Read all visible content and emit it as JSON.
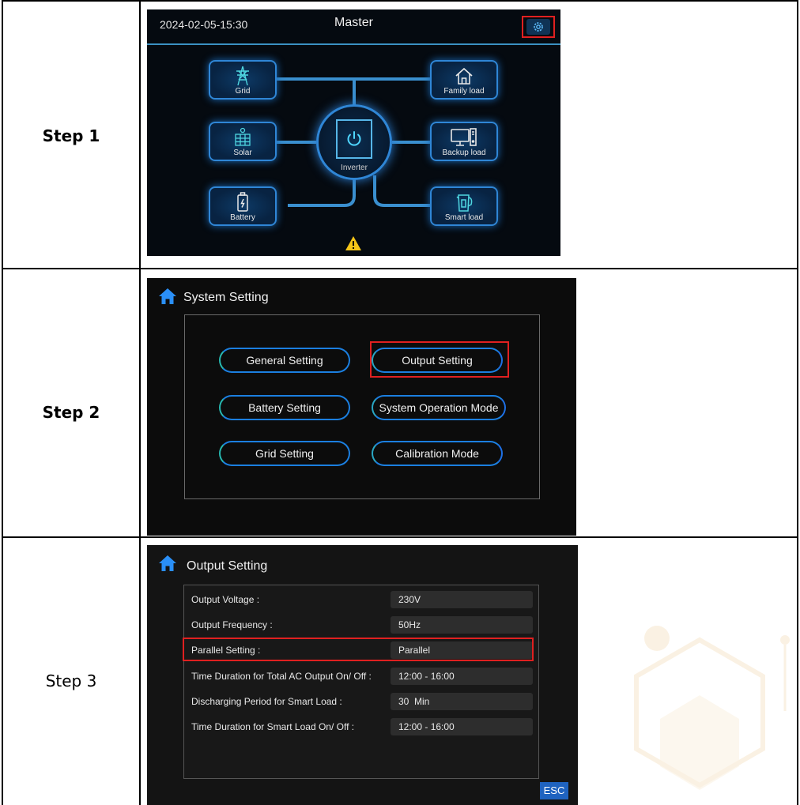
{
  "steps": [
    {
      "label": "Step 1"
    },
    {
      "label": "Step 2"
    },
    {
      "label": "Step 3"
    }
  ],
  "screen1": {
    "datetime": "2024-02-05-15:30",
    "title": "Master",
    "nodes": {
      "grid": "Grid",
      "solar": "Solar",
      "battery": "Battery",
      "family_load": "Family load",
      "backup_load": "Backup load",
      "smart_load": "Smart load",
      "inverter": "Inverter"
    },
    "accent_color": "#2f86d6",
    "highlight_color": "#e02020"
  },
  "screen2": {
    "title": "System Setting",
    "buttons": {
      "general": "General Setting",
      "output": "Output Setting",
      "battery": "Battery Setting",
      "operation_mode": "System Operation Mode",
      "grid": "Grid Setting",
      "calibration": "Calibration Mode"
    }
  },
  "screen3": {
    "title": "Output Setting",
    "rows": [
      {
        "label": "Output Voltage :",
        "value": "230V"
      },
      {
        "label": "Output Frequency :",
        "value": "50Hz"
      },
      {
        "label": "Parallel Setting :",
        "value": "Parallel"
      },
      {
        "label": "Time Duration for Total AC Output On/ Off :",
        "value": "12:00 - 16:00"
      },
      {
        "label": "Discharging Period for Smart Load :",
        "value": "30  Min"
      },
      {
        "label": "Time Duration for Smart Load On/ Off :",
        "value": "12:00 - 16:00"
      }
    ],
    "esc_label": "ESC"
  }
}
